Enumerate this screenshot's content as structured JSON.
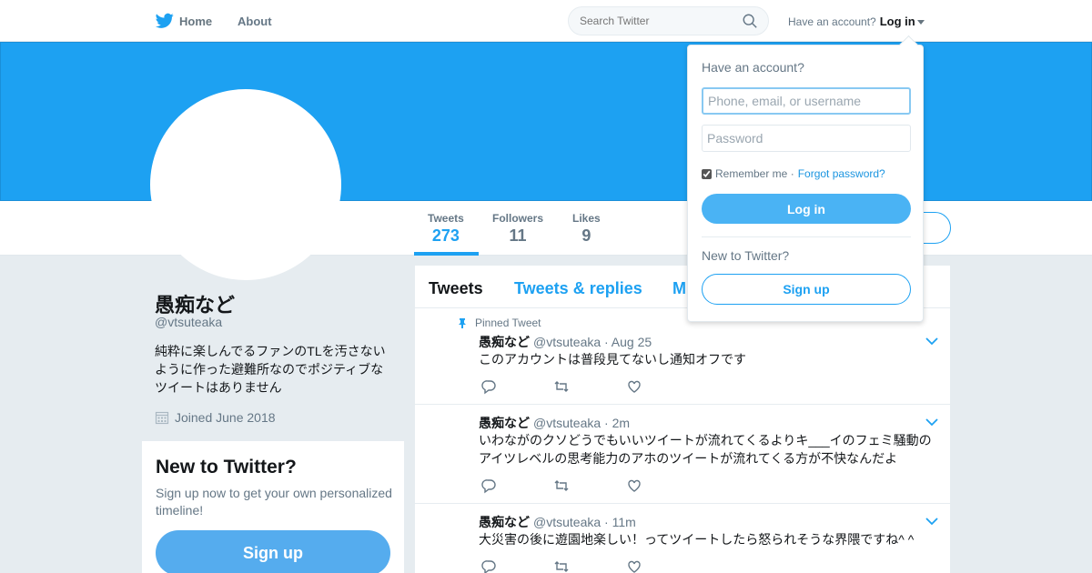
{
  "topbar": {
    "logo_icon": "twitter-bird-icon",
    "nav": [
      {
        "label": "Home"
      },
      {
        "label": "About"
      }
    ],
    "search_placeholder": "Search Twitter",
    "have_account": "Have an account?",
    "login_label": "Log in"
  },
  "colors": {
    "brand": "#1da1f2",
    "banner": "#1da1f2",
    "button": "#4ab3f4"
  },
  "profile": {
    "name": "愚痴など",
    "handle": "@vtsuteaka",
    "bio": "純粋に楽しんでるファンのTLを汚さないように作った避難所なのでポジティブなツイートはありません",
    "joined": "Joined June 2018"
  },
  "stats": [
    {
      "label": "Tweets",
      "value": "273"
    },
    {
      "label": "Followers",
      "value": "11"
    },
    {
      "label": "Likes",
      "value": "9"
    }
  ],
  "signup_card": {
    "title": "New to Twitter?",
    "text": "Sign up now to get your own personalized timeline!",
    "button": "Sign up"
  },
  "timeline": {
    "tabs": [
      {
        "label": "Tweets"
      },
      {
        "label": "Tweets & replies"
      },
      {
        "label": "M"
      }
    ],
    "pinned_label": "Pinned Tweet",
    "tweets": [
      {
        "name": "愚痴など",
        "meta": "@vtsuteaka · Aug 25",
        "text": "このアカウントは普段見てないし通知オフです"
      },
      {
        "name": "愚痴など",
        "meta": "@vtsuteaka · 2m",
        "text": "いわながのクソどうでもいいツイートが流れてくるよりキ___イのフェミ騒動のアイツレベルの思考能力のアホのツイートが流れてくる方が不快なんだよ"
      },
      {
        "name": "愚痴など",
        "meta": "@vtsuteaka · 11m",
        "text": "大災害の後に遊園地楽しい！ってツイートしたら怒られそうな界隈ですね^ ^"
      }
    ]
  },
  "login_dropdown": {
    "title": "Have an account?",
    "username_placeholder": "Phone, email, or username",
    "password_placeholder": "Password",
    "remember": "Remember me ·",
    "forgot": "Forgot password?",
    "login_button": "Log in",
    "new_label": "New to Twitter?",
    "signup_button": "Sign up"
  }
}
